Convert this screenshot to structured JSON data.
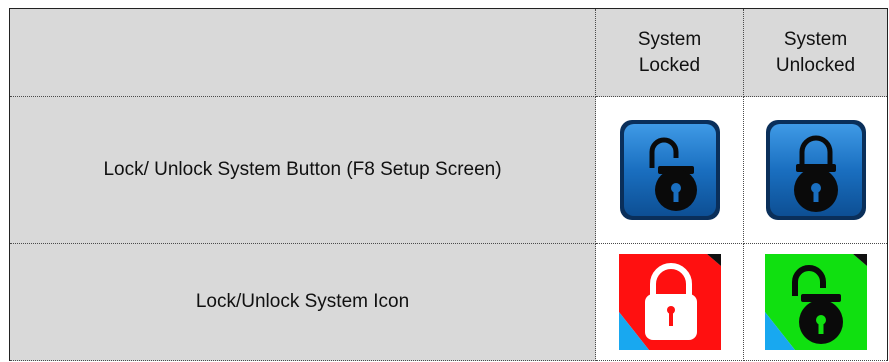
{
  "header": {
    "col_locked": "System\nLocked",
    "col_unlocked": "System\nUnlocked"
  },
  "rows": [
    {
      "label": "Lock/ Unlock System Button (F8 Setup Screen)",
      "locked_icon": "open-padlock-blue-button-icon",
      "unlocked_icon": "closed-padlock-blue-button-icon"
    },
    {
      "label": "Lock/Unlock System Icon",
      "locked_icon": "closed-padlock-red-icon",
      "unlocked_icon": "open-padlock-green-icon"
    }
  ],
  "colors": {
    "button_blue": "#1a6fc0",
    "red": "#ff1010",
    "green": "#10e010",
    "sky": "#18a8f0",
    "header_gray": "#d9d9d9"
  }
}
